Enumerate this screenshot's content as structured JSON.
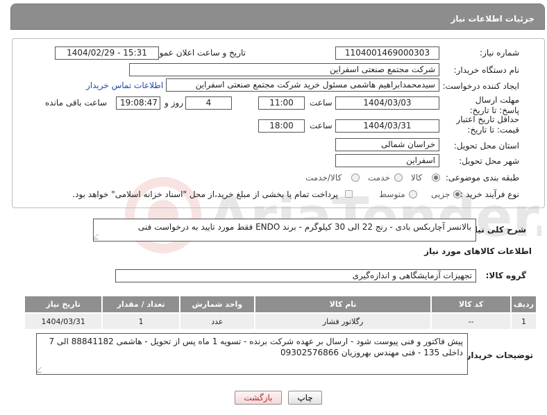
{
  "header": {
    "title": "جزئیات اطلاعات نیاز"
  },
  "form": {
    "need_number": {
      "label": "شماره نیاز:",
      "value": "1104001469000303"
    },
    "announce_datetime": {
      "label": "تاریخ و ساعت اعلان عمومی:",
      "value": "1404/02/29 - 15:31"
    },
    "buyer_org": {
      "label": "نام دستگاه خریدار:",
      "value": "شرکت مجتمع صنعتی اسفراین"
    },
    "requester": {
      "label": "ایجاد کننده درخواست:",
      "value": "سیدمحمدابراهیم هاشمی مسئول خرید شرکت مجتمع صنعتی اسفراین",
      "contact_link": "اطلاعات تماس خریدار"
    },
    "reply_deadline": {
      "label": "مهلت ارسال پاسخ: تا تاریخ:",
      "date": "1404/03/03",
      "time_label": "ساعت",
      "time": "11:00",
      "days": "4",
      "days_label": "روز و",
      "remaining": "19:08:47",
      "remaining_label": "ساعت باقی مانده"
    },
    "price_validity": {
      "label": "حداقل تاریخ اعتبار قیمت: تا تاریخ:",
      "date": "1404/03/31",
      "time_label": "ساعت",
      "time": "18:00"
    },
    "delivery_province": {
      "label": "استان محل تحویل:",
      "value": "خراسان شمالی"
    },
    "delivery_city": {
      "label": "شهر محل تحویل:",
      "value": "اسفراین"
    },
    "category": {
      "label": "طبقه بندی موضوعی:",
      "options": [
        "کالا",
        "خدمت",
        "کالا/خدمت"
      ],
      "selected": "کالا"
    },
    "process_type": {
      "label": "نوع فرآیند خرید :",
      "options": [
        "جزیی",
        "متوسط"
      ],
      "selected": "جزیی",
      "payment_note": "پرداخت تمام یا بخشی از مبلغ خرید،از محل \"اسناد خزانه اسلامی\" خواهد بود."
    }
  },
  "general_description": {
    "label": "شرح کلی نیاز:",
    "value": "بالانسر آچاربکس بادی  - رنج 22 الی 30 کیلوگرم - برند ENDO فقط مورد تایید به درخواست فنی"
  },
  "goods_section": {
    "title": "اطلاعات کالاهای مورد نیاز",
    "group_label": "گروه کالا:",
    "group_value": "تجهیزات آزمایشگاهی و اندازه‌گیری",
    "table": {
      "headers": [
        "ردیف",
        "کد کالا",
        "نام کالا",
        "واحد شمارش",
        "تعداد / مقدار",
        "تاریخ نیاز"
      ],
      "rows": [
        [
          "1",
          "--",
          "رگلاتور فشار",
          "عدد",
          "1",
          "1404/03/31"
        ]
      ]
    }
  },
  "buyer_notes": {
    "label": "توضیحات خریدار:",
    "value": "پیش فاکتور و فنی پیوست شود - ارسال بر عهده شرکت برنده - تسویه 1 ماه پس از تحویل - هاشمی 88841182 الی 7 داخلی 135 - فنی مهندس بهروزیان 09302576866"
  },
  "buttons": {
    "print": "چاپ",
    "back": "بازگشت"
  },
  "colors": {
    "header_bg": "#8d8d8d",
    "table_header_bg": "#8f8f8f",
    "link": "#1a4fa0",
    "back_text": "#b03030"
  }
}
